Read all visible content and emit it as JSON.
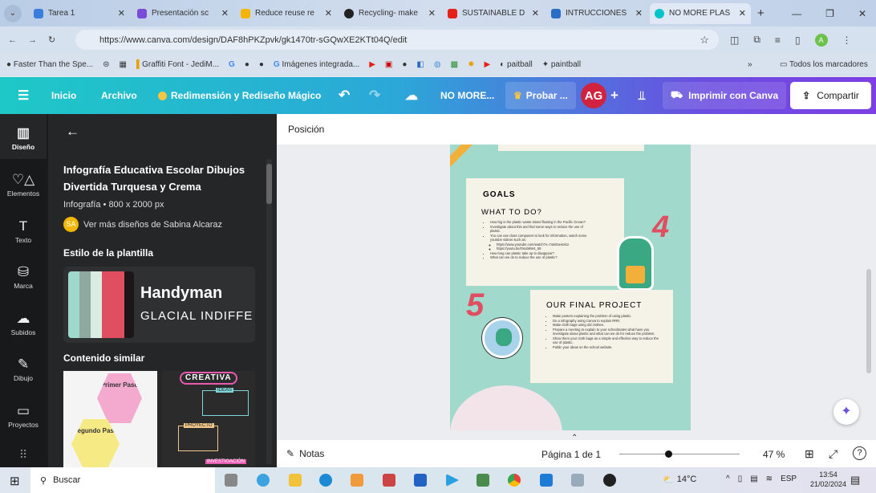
{
  "browser": {
    "tabs": [
      {
        "title": "Tarea 1",
        "color": "#3b7ddd"
      },
      {
        "title": "Presentación sc",
        "color": "#7a4bd8"
      },
      {
        "title": "Reduce reuse re",
        "color": "#f4b400"
      },
      {
        "title": "Recycling- make",
        "color": "#222222"
      },
      {
        "title": "SUSTAINABLE D",
        "color": "#e62117"
      },
      {
        "title": "INTRUCCIONES",
        "color": "#2b6cc4"
      },
      {
        "title": "NO MORE PLAS",
        "color": "#00c4cc"
      }
    ],
    "url": "https://www.canva.com/design/DAF8hPKZpvk/gk1470tr-sGQwXE2KTt04Q/edit",
    "profile_initial": "A",
    "bookmarks": [
      "Faster Than the Spe...",
      "Graffiti Font - JediM...",
      "Imágenes integrada...",
      "paitball",
      "paintball"
    ],
    "all_bookmarks": "Todos los marcadores"
  },
  "toolbar": {
    "inicio": "Inicio",
    "archivo": "Archivo",
    "magic": "Redimensión y Rediseño Mágico",
    "doc_title": "NO MORE...",
    "try": "Probar ...",
    "avatar": "AG",
    "print": "Imprimir con Canva",
    "share": "Compartir"
  },
  "rail": [
    {
      "label": "Diseño",
      "icon": "▥"
    },
    {
      "label": "Elementos",
      "icon": "♡△"
    },
    {
      "label": "Texto",
      "icon": "T"
    },
    {
      "label": "Marca",
      "icon": "⛁"
    },
    {
      "label": "Subidos",
      "icon": "☁"
    },
    {
      "label": "Dibujo",
      "icon": "✎"
    },
    {
      "label": "Proyectos",
      "icon": "▭"
    }
  ],
  "panel": {
    "title": "Infografía Educativa Escolar Dibujos Divertida Turquesa y Crema",
    "meta": "Infografía • 800 x 2000 px",
    "author_initials": "SA",
    "author_link": "Ver más diseños de Sabina Alcaraz",
    "style_heading": "Estilo de la plantilla",
    "font1": "Handyman",
    "font2": "GLACIAL INDIFFE",
    "palette": [
      "#9fd8cc",
      "#8fa8a0",
      "#d8ece4",
      "#e04f5f",
      "#1d1618"
    ],
    "similar_heading": "Contenido similar",
    "similar1": {
      "a": "Primer Paso",
      "b": "Segundo Paso"
    },
    "similar2": {
      "a": "CREATIVA",
      "b": "IDEAS",
      "c": "PROYECTO",
      "d": "INVESTIGACIÓN"
    }
  },
  "canvas": {
    "position_label": "Posición",
    "goals": "GOALS",
    "what": "WHAT TO DO?",
    "what_items": [
      "How big is the plastic waste island floating in the Pacific Ocean?",
      "Investigate about this and find some ways to reduce the use of plastic.",
      "You can use class computers to look for information, watch some youtube videos such as:",
      "https://www.youtube.com/watch?v=7uMGw4ek1I",
      "https://youtu.be/Osub9W4_58",
      "How long can plastic take up to disappear?",
      "What can we do to reduce the use of plastic?"
    ],
    "num4": "4",
    "num5": "5",
    "final": "OUR FINAL PROJECT",
    "final_items": [
      "Make posters explaining the problem of using plastic.",
      "Do a infography using Canva to explain RRR.",
      "Make cloth bags using old clothes.",
      "Prepare a meeting to explain to your schoolmates what have you investigate about plastic and what can we do for reduce the problem.",
      "Show them your cloth bags as a simple and effective way to reduce the use of plastic.",
      "Public your ideas on the school website."
    ]
  },
  "bottom": {
    "notes": "Notas",
    "page": "Página 1 de 1",
    "zoom": "47 %",
    "zoom_fraction": 0.47
  },
  "taskbar": {
    "search": "Buscar",
    "weather": "14°C",
    "lang": "ESP",
    "time": "13:54",
    "date": "21/02/2024"
  }
}
